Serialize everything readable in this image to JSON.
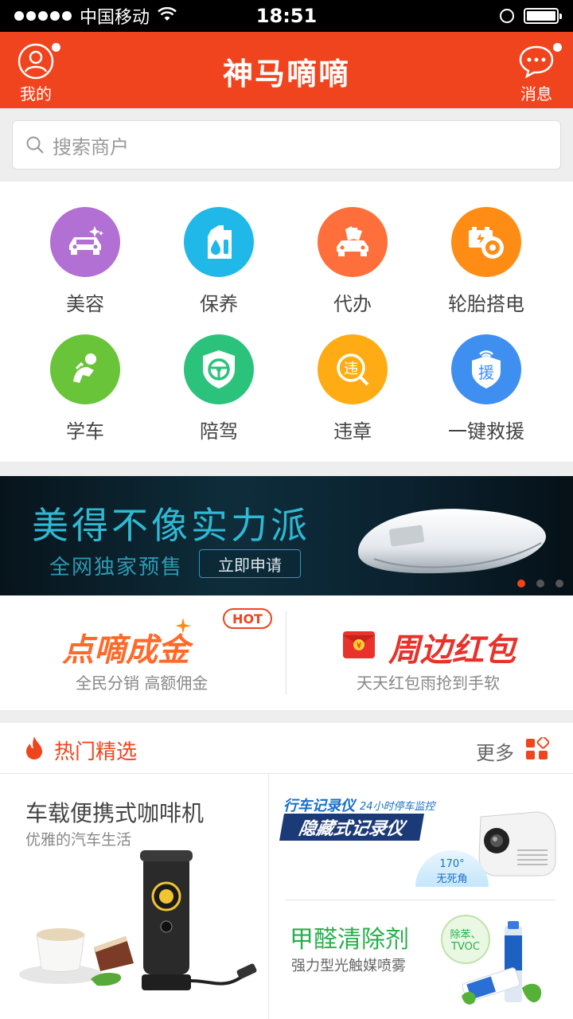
{
  "status_bar": {
    "carrier": "中国移动",
    "time": "18:51"
  },
  "header": {
    "title": "神马嘀嘀",
    "left_label": "我的",
    "right_label": "消息"
  },
  "search": {
    "placeholder": "搜索商户"
  },
  "categories": [
    {
      "label": "美容",
      "color": "#b26fd4"
    },
    {
      "label": "保养",
      "color": "#1fb8e8"
    },
    {
      "label": "代办",
      "color": "#ff6f3c"
    },
    {
      "label": "轮胎搭电",
      "color": "#ff8c14"
    },
    {
      "label": "学车",
      "color": "#6ac43a"
    },
    {
      "label": "陪驾",
      "color": "#2bc27c"
    },
    {
      "label": "违章",
      "color": "#ffac14"
    },
    {
      "label": "一键救援",
      "color": "#3f8ff0"
    }
  ],
  "banner": {
    "headline": "美得不像实力派",
    "subline": "全网独家预售",
    "button_label": "立即申请"
  },
  "promos": [
    {
      "title": "点嘀成金",
      "badge": "HOT",
      "desc": "全民分销 高额佣金"
    },
    {
      "title": "周边红包",
      "desc": "天天红包雨抢到手软"
    }
  ],
  "hot_section": {
    "title": "热门精选",
    "more_label": "更多"
  },
  "products": [
    {
      "title": "车载便携式咖啡机",
      "subtitle": "优雅的汽车生活"
    },
    {
      "title": "隐藏式记录仪",
      "tag": "行车记录仪",
      "tag2": "24小时停车监控",
      "badge": "170°",
      "badge2": "无死角"
    },
    {
      "title": "甲醛清除剂",
      "subtitle": "强力型光触媒喷雾",
      "badge": "除苯、",
      "badge2": "TVOC"
    }
  ],
  "colors": {
    "accent": "#f0441e",
    "brand_green": "#27b04a"
  }
}
